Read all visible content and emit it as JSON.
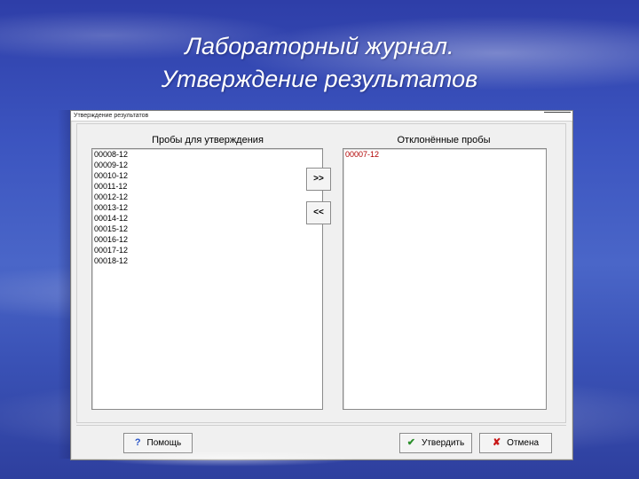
{
  "slide": {
    "title_line1": "Лабораторный журнал.",
    "title_line2": "Утверждение результатов"
  },
  "window": {
    "caption": "Утверждение результатов"
  },
  "left_list": {
    "label": "Пробы для утверждения",
    "items": [
      "00008-12",
      "00009-12",
      "00010-12",
      "00011-12",
      "00012-12",
      "00013-12",
      "00014-12",
      "00015-12",
      "00016-12",
      "00017-12",
      "00018-12"
    ]
  },
  "right_list": {
    "label": "Отклонённые пробы",
    "items": [
      "00007-12"
    ]
  },
  "move_buttons": {
    "to_right": ">>",
    "to_left": "<<"
  },
  "footer": {
    "help_label": "Помощь",
    "approve_label": "Утвердить",
    "cancel_label": "Отмена",
    "help_icon": "question-icon",
    "approve_icon": "checkmark-icon",
    "cancel_icon": "x-icon"
  },
  "colors": {
    "rejected_text": "#b00000",
    "approve_icon": "#2b8f2b",
    "cancel_icon": "#c81818",
    "help_icon": "#2a55c8"
  }
}
